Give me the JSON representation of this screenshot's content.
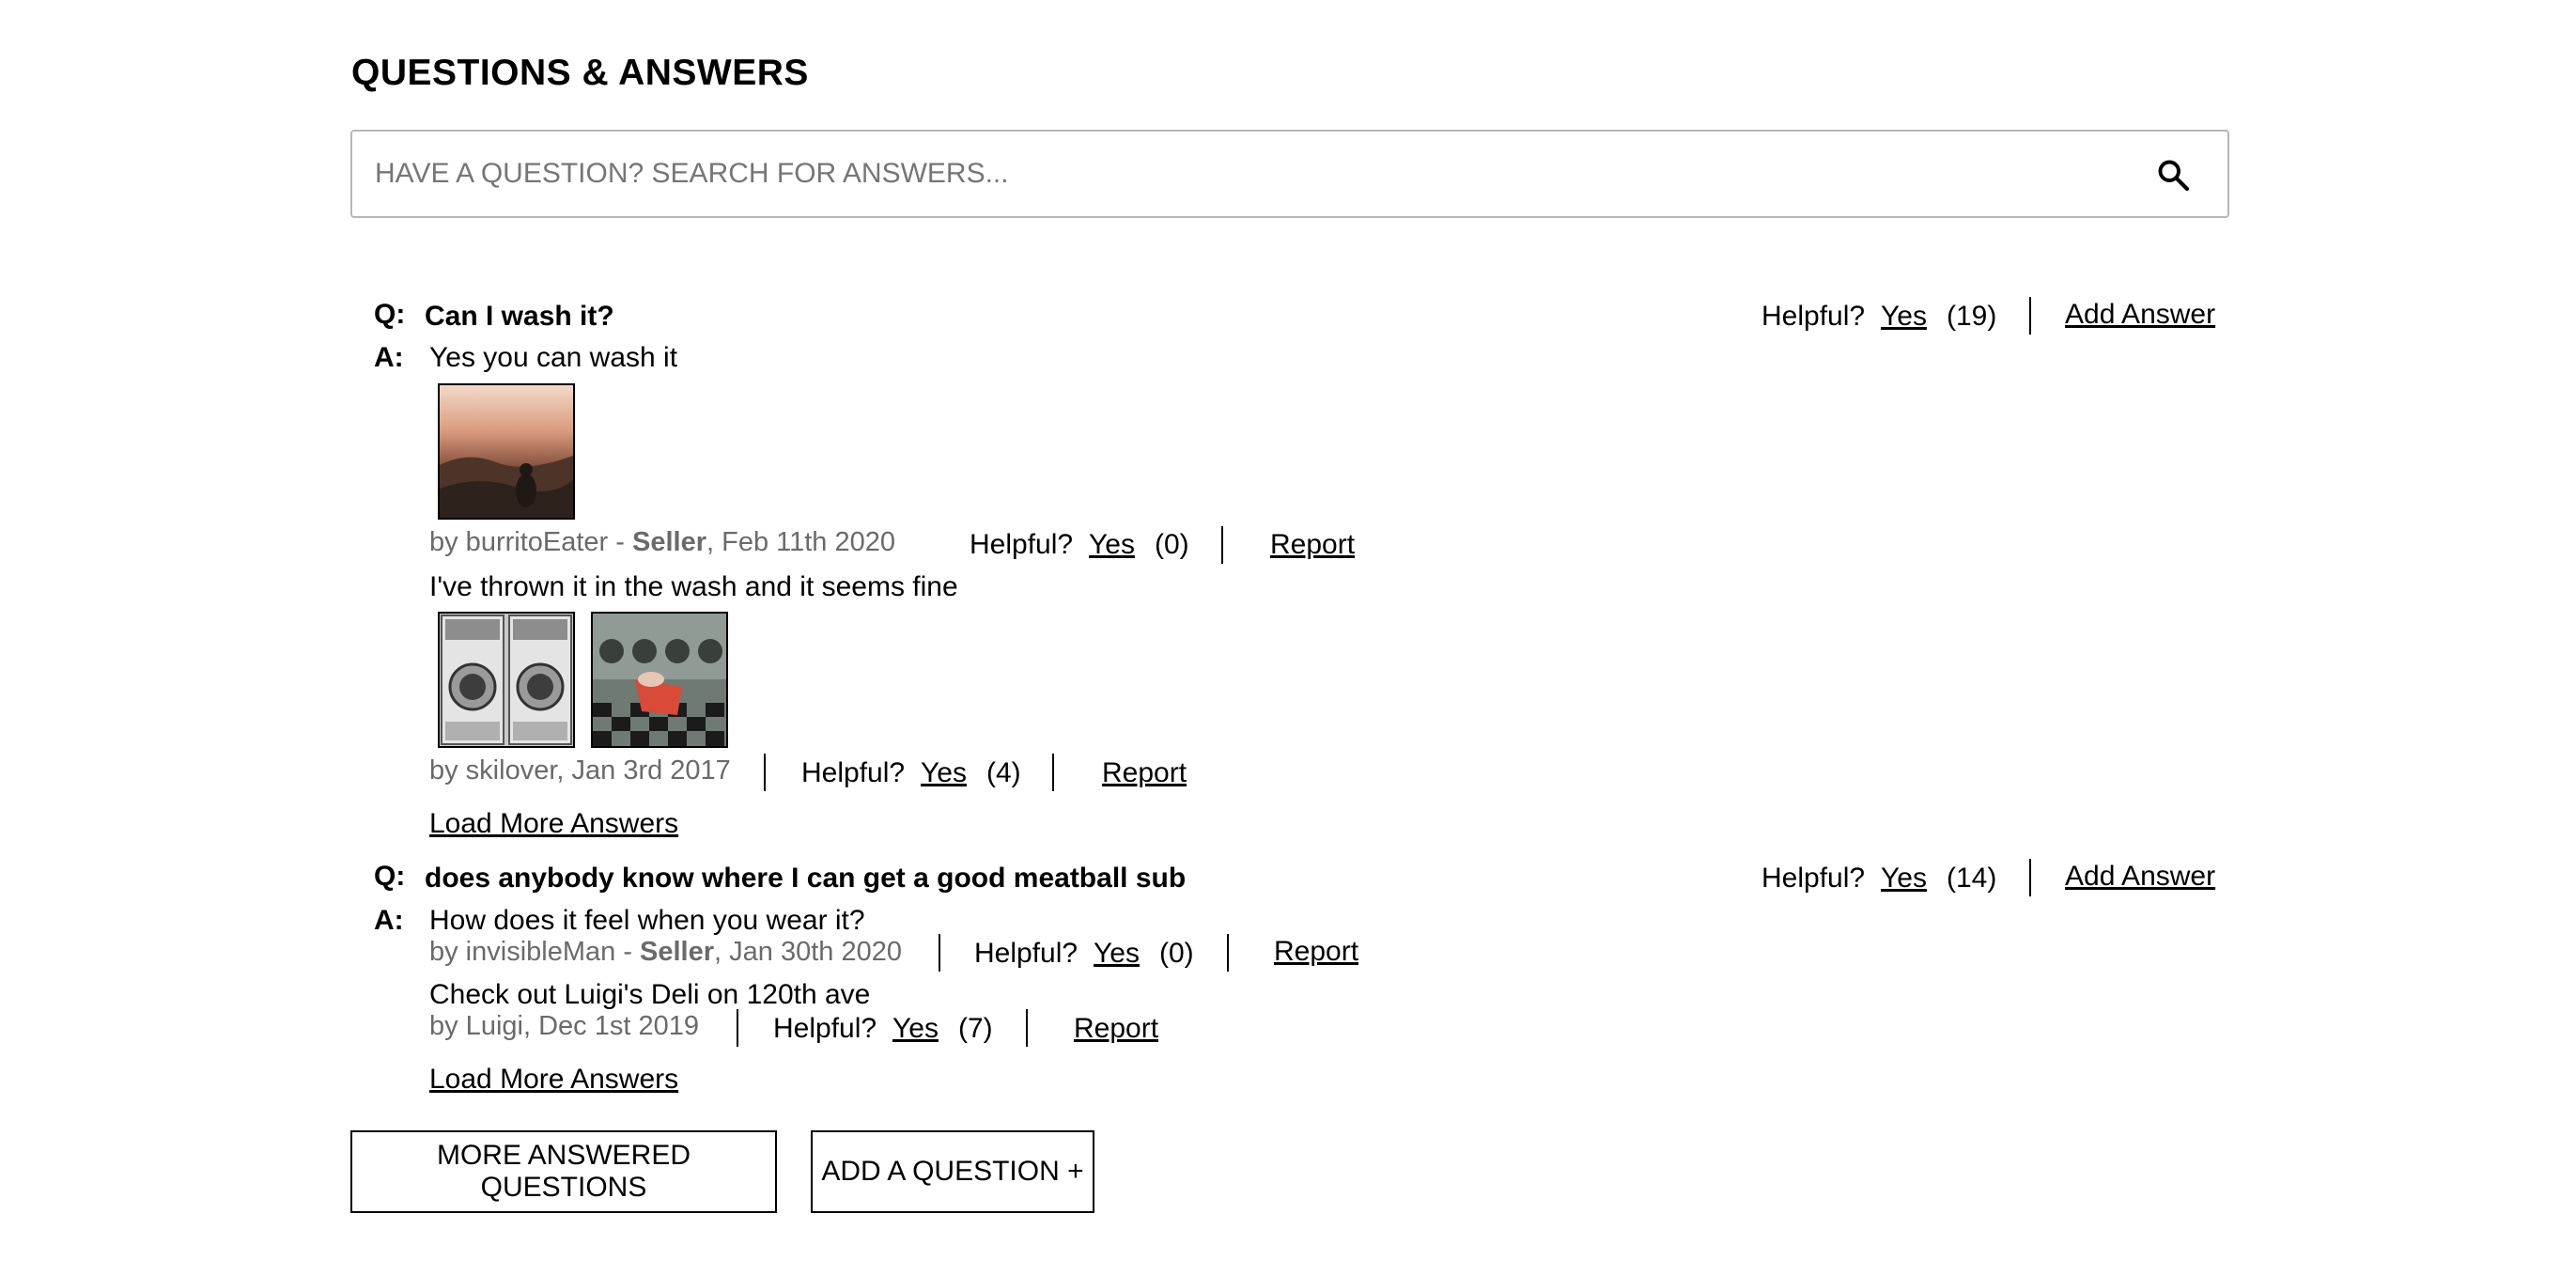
{
  "section_title": "QUESTIONS & ANSWERS",
  "search": {
    "placeholder": "HAVE A QUESTION? SEARCH FOR ANSWERS...",
    "icon": "search-icon"
  },
  "labels": {
    "q": "Q:",
    "a": "A:",
    "helpful": "Helpful?",
    "yes": "Yes",
    "report": "Report",
    "add_answer": "Add Answer",
    "load_more": "Load More Answers",
    "seller": "Seller"
  },
  "questions": [
    {
      "body": "Can I wash it?",
      "helpful_count": "(19)",
      "answers": [
        {
          "body": "Yes you can wash it",
          "by_prefix": "by burritoEater - ",
          "seller": "Seller",
          "date": ", Feb 11th 2020",
          "helpful_count": "(0)",
          "photos": [
            "sunset-landscape-photo"
          ]
        },
        {
          "body": "I've thrown it in the wash and it seems fine",
          "by_prefix": "by skilover, Jan 3rd 2017",
          "helpful_count": "(4)",
          "photos": [
            "washing-machines-photo",
            "laundromat-cart-photo"
          ]
        }
      ]
    },
    {
      "body": "does anybody know where I can get a good meatball sub",
      "helpful_count": "(14)",
      "answers": [
        {
          "body": "How does it feel when you wear it?",
          "by_prefix": "by invisibleMan - ",
          "seller": "Seller",
          "date": ", Jan 30th 2020",
          "helpful_count": "(0)"
        },
        {
          "body": "Check out Luigi's Deli on 120th ave",
          "by_prefix": "by Luigi, Dec 1st 2019",
          "helpful_count": "(7)"
        }
      ]
    }
  ],
  "buttons": {
    "more_questions": "MORE ANSWERED QUESTIONS",
    "add_question": "ADD A QUESTION +"
  }
}
